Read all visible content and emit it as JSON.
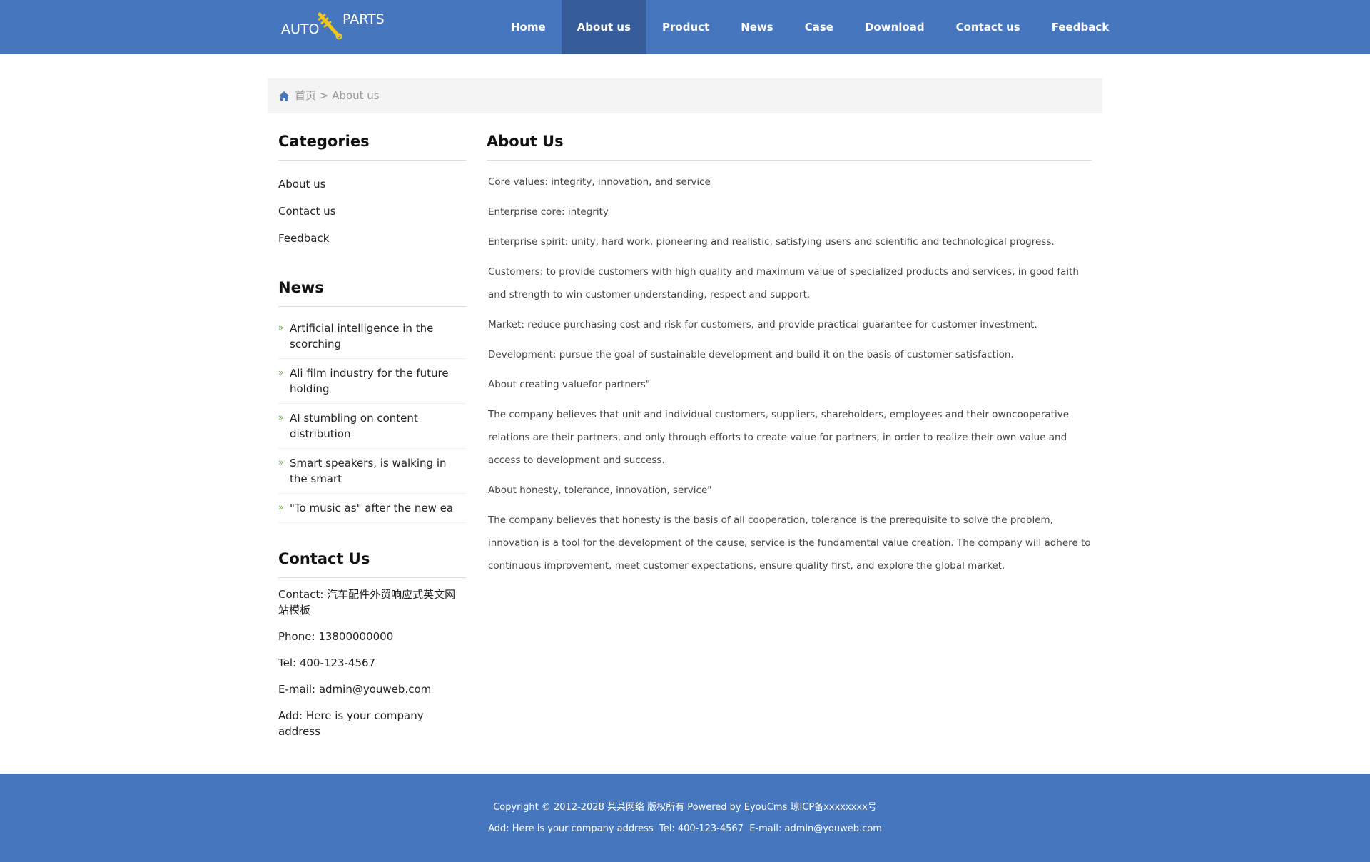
{
  "logo": {
    "left": "AUTO",
    "right": "PARTS"
  },
  "nav": [
    "Home",
    "About us",
    "Product",
    "News",
    "Case",
    "Download",
    "Contact us",
    "Feedback"
  ],
  "breadcrumb": {
    "home": "首页",
    "sep": ">",
    "current": "About us"
  },
  "sidebar": {
    "categories_title": "Categories",
    "categories": [
      "About us",
      "Contact us",
      "Feedback"
    ],
    "news_title": "News",
    "news": [
      "Artificial intelligence in the scorching",
      "Ali film industry for the future holding",
      "AI stumbling on content distribution",
      "Smart speakers, is walking in the smart",
      "\"To music as\" after the new ea"
    ],
    "contact_title": "Contact Us",
    "contact": [
      "Contact: 汽车配件外贸响应式英文网站模板",
      "Phone: 13800000000",
      "Tel: 400-123-4567",
      "E-mail: admin@youweb.com",
      "Add: Here is your company address"
    ]
  },
  "main": {
    "title": "About Us",
    "paragraphs": [
      "Core values: integrity, innovation, and service",
      "Enterprise core: integrity",
      "Enterprise spirit: unity, hard work, pioneering and realistic, satisfying users and scientific and technological progress.",
      "Customers: to provide customers with high quality and maximum value of specialized products and services, in good faith and strength to win customer understanding, respect and support.",
      "Market: reduce purchasing cost and risk for customers, and provide practical guarantee for customer investment.",
      "Development: pursue the goal of sustainable development and build it on the basis of customer satisfaction.",
      "About creating valuefor partners\"",
      "The company believes that unit and individual customers, suppliers, shareholders, employees and their owncooperative relations are their partners, and only through efforts to create value for partners, in order to realize their own value and access to development and success.",
      "About honesty, tolerance, innovation, service\"",
      "The company believes that honesty is the basis of all cooperation, tolerance is the prerequisite to solve the problem, innovation is a tool for the development of the cause, service is the fundamental value creation. The company will adhere to continuous improvement, meet customer expectations, ensure quality first, and explore the global market."
    ]
  },
  "footer": {
    "copyright": "Copyright © 2012-2028 某某网络 版权所有 Powered by EyouCms 琼ICP备xxxxxxxx号",
    "address": "Add: Here is your company address  Tel: 400-123-4567  E-mail: admin@youweb.com"
  },
  "colors": {
    "brand": "#4676be",
    "nav_active": "#365d99",
    "bullet": "#5aa832"
  }
}
